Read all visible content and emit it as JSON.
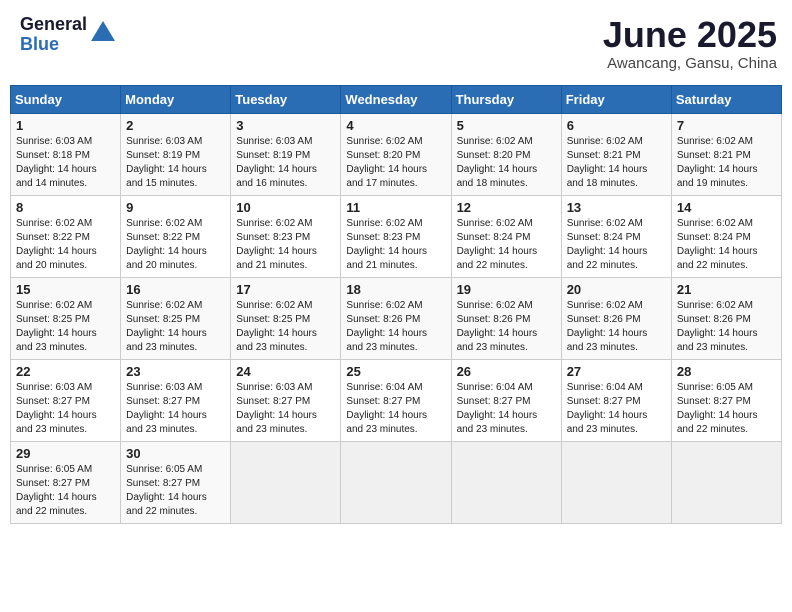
{
  "logo": {
    "general": "General",
    "blue": "Blue"
  },
  "header": {
    "month": "June 2025",
    "location": "Awancang, Gansu, China"
  },
  "weekdays": [
    "Sunday",
    "Monday",
    "Tuesday",
    "Wednesday",
    "Thursday",
    "Friday",
    "Saturday"
  ],
  "weeks": [
    [
      {
        "day": "1",
        "sunrise": "6:03 AM",
        "sunset": "8:18 PM",
        "daylight": "14 hours and 14 minutes."
      },
      {
        "day": "2",
        "sunrise": "6:03 AM",
        "sunset": "8:19 PM",
        "daylight": "14 hours and 15 minutes."
      },
      {
        "day": "3",
        "sunrise": "6:03 AM",
        "sunset": "8:19 PM",
        "daylight": "14 hours and 16 minutes."
      },
      {
        "day": "4",
        "sunrise": "6:02 AM",
        "sunset": "8:20 PM",
        "daylight": "14 hours and 17 minutes."
      },
      {
        "day": "5",
        "sunrise": "6:02 AM",
        "sunset": "8:20 PM",
        "daylight": "14 hours and 18 minutes."
      },
      {
        "day": "6",
        "sunrise": "6:02 AM",
        "sunset": "8:21 PM",
        "daylight": "14 hours and 18 minutes."
      },
      {
        "day": "7",
        "sunrise": "6:02 AM",
        "sunset": "8:21 PM",
        "daylight": "14 hours and 19 minutes."
      }
    ],
    [
      {
        "day": "8",
        "sunrise": "6:02 AM",
        "sunset": "8:22 PM",
        "daylight": "14 hours and 20 minutes."
      },
      {
        "day": "9",
        "sunrise": "6:02 AM",
        "sunset": "8:22 PM",
        "daylight": "14 hours and 20 minutes."
      },
      {
        "day": "10",
        "sunrise": "6:02 AM",
        "sunset": "8:23 PM",
        "daylight": "14 hours and 21 minutes."
      },
      {
        "day": "11",
        "sunrise": "6:02 AM",
        "sunset": "8:23 PM",
        "daylight": "14 hours and 21 minutes."
      },
      {
        "day": "12",
        "sunrise": "6:02 AM",
        "sunset": "8:24 PM",
        "daylight": "14 hours and 22 minutes."
      },
      {
        "day": "13",
        "sunrise": "6:02 AM",
        "sunset": "8:24 PM",
        "daylight": "14 hours and 22 minutes."
      },
      {
        "day": "14",
        "sunrise": "6:02 AM",
        "sunset": "8:24 PM",
        "daylight": "14 hours and 22 minutes."
      }
    ],
    [
      {
        "day": "15",
        "sunrise": "6:02 AM",
        "sunset": "8:25 PM",
        "daylight": "14 hours and 23 minutes."
      },
      {
        "day": "16",
        "sunrise": "6:02 AM",
        "sunset": "8:25 PM",
        "daylight": "14 hours and 23 minutes."
      },
      {
        "day": "17",
        "sunrise": "6:02 AM",
        "sunset": "8:25 PM",
        "daylight": "14 hours and 23 minutes."
      },
      {
        "day": "18",
        "sunrise": "6:02 AM",
        "sunset": "8:26 PM",
        "daylight": "14 hours and 23 minutes."
      },
      {
        "day": "19",
        "sunrise": "6:02 AM",
        "sunset": "8:26 PM",
        "daylight": "14 hours and 23 minutes."
      },
      {
        "day": "20",
        "sunrise": "6:02 AM",
        "sunset": "8:26 PM",
        "daylight": "14 hours and 23 minutes."
      },
      {
        "day": "21",
        "sunrise": "6:02 AM",
        "sunset": "8:26 PM",
        "daylight": "14 hours and 23 minutes."
      }
    ],
    [
      {
        "day": "22",
        "sunrise": "6:03 AM",
        "sunset": "8:27 PM",
        "daylight": "14 hours and 23 minutes."
      },
      {
        "day": "23",
        "sunrise": "6:03 AM",
        "sunset": "8:27 PM",
        "daylight": "14 hours and 23 minutes."
      },
      {
        "day": "24",
        "sunrise": "6:03 AM",
        "sunset": "8:27 PM",
        "daylight": "14 hours and 23 minutes."
      },
      {
        "day": "25",
        "sunrise": "6:04 AM",
        "sunset": "8:27 PM",
        "daylight": "14 hours and 23 minutes."
      },
      {
        "day": "26",
        "sunrise": "6:04 AM",
        "sunset": "8:27 PM",
        "daylight": "14 hours and 23 minutes."
      },
      {
        "day": "27",
        "sunrise": "6:04 AM",
        "sunset": "8:27 PM",
        "daylight": "14 hours and 23 minutes."
      },
      {
        "day": "28",
        "sunrise": "6:05 AM",
        "sunset": "8:27 PM",
        "daylight": "14 hours and 22 minutes."
      }
    ],
    [
      {
        "day": "29",
        "sunrise": "6:05 AM",
        "sunset": "8:27 PM",
        "daylight": "14 hours and 22 minutes."
      },
      {
        "day": "30",
        "sunrise": "6:05 AM",
        "sunset": "8:27 PM",
        "daylight": "14 hours and 22 minutes."
      },
      null,
      null,
      null,
      null,
      null
    ]
  ],
  "labels": {
    "sunrise": "Sunrise:",
    "sunset": "Sunset:",
    "daylight": "Daylight:"
  }
}
